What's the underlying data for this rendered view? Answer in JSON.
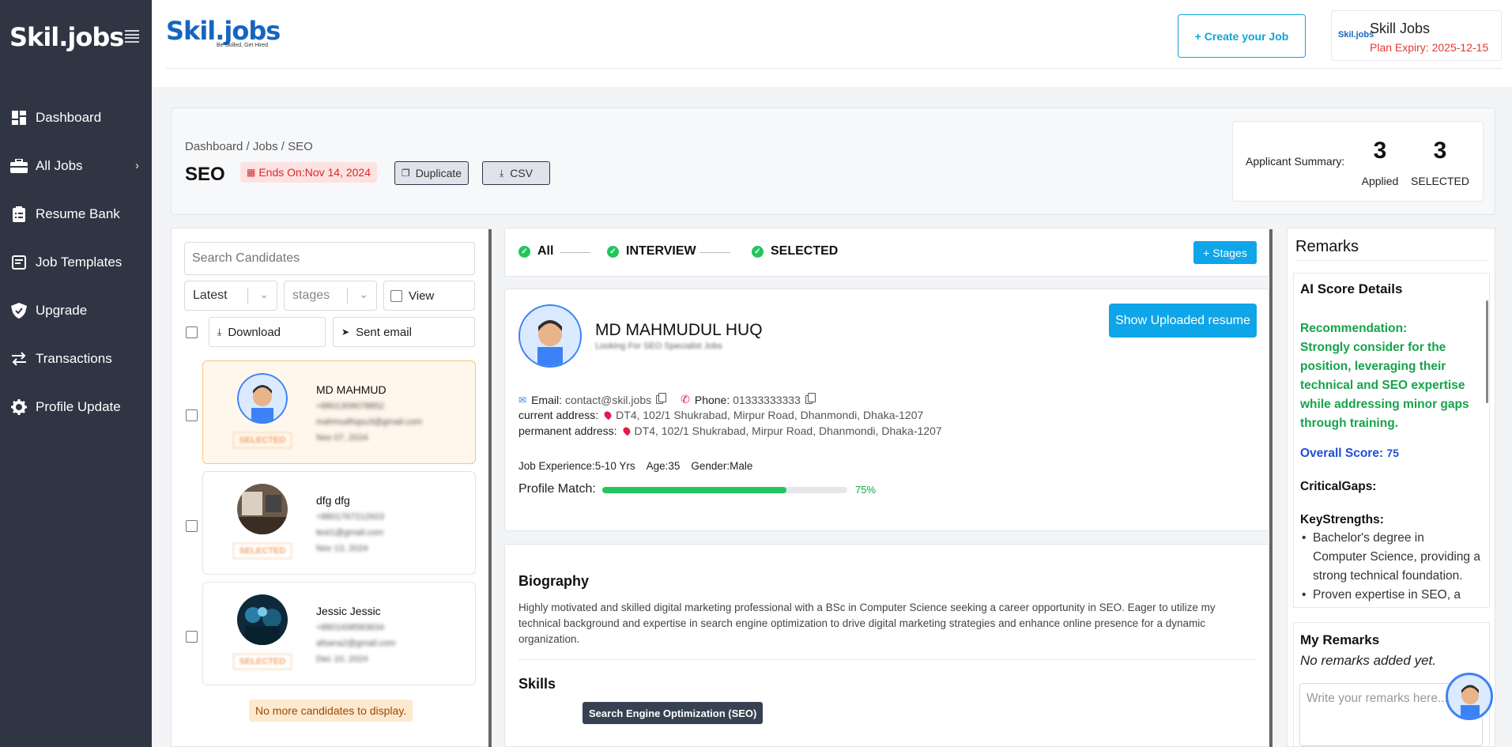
{
  "sidebar": {
    "logo": "Skil.jobs",
    "items": [
      {
        "label": "Dashboard",
        "icon": "dashboard-icon"
      },
      {
        "label": "All Jobs",
        "icon": "briefcase-icon"
      },
      {
        "label": "Resume Bank",
        "icon": "clipboard-icon"
      },
      {
        "label": "Job Templates",
        "icon": "template-icon"
      },
      {
        "label": "Upgrade",
        "icon": "shield-icon"
      },
      {
        "label": "Transactions",
        "icon": "transfer-icon"
      },
      {
        "label": "Profile Update",
        "icon": "gear-icon"
      }
    ]
  },
  "header": {
    "logo": "Skil.jobs",
    "tagline": "Be Skilled, Get Hired",
    "create_label": "+ Create your Job",
    "plan_logo": "Skil.jobs",
    "plan_name": "Skill Jobs",
    "plan_expiry": "Plan Expiry: 2025-12-15"
  },
  "job": {
    "breadcrumb": "Dashboard / Jobs / SEO",
    "title": "SEO",
    "ends": "Ends On:Nov 14, 2024",
    "duplicate_label": "Duplicate",
    "csv_label": "CSV",
    "summary_label": "Applicant Summary:",
    "applied_count": "3",
    "applied_label": "Applied",
    "selected_count": "3",
    "selected_label": "SELECTED"
  },
  "candidates": {
    "search_placeholder": "Search Candidates",
    "sort_value": "Latest",
    "stages_value": "stages",
    "view_label": "View",
    "download_label": "Download",
    "email_label": "Sent email",
    "no_more": "No more candidates to display.",
    "list": [
      {
        "name": "MD MAHMUD",
        "phone": "+8801309078852",
        "email": "mahmudhqsu3@gmail.com",
        "date": "Nov 07, 2024",
        "status": "SELECTED"
      },
      {
        "name": "dfg dfg",
        "phone": "+8801767212923",
        "email": "test1@gmail.com",
        "date": "Nov 13, 2024",
        "status": "SELECTED"
      },
      {
        "name": "Jessic Jessic",
        "phone": "+8801938583634",
        "email": "afsana2@gmail.com",
        "date": "Dec 10, 2024",
        "status": "SELECTED"
      }
    ]
  },
  "stages": {
    "items": [
      "All",
      "INTERVIEW",
      "SELECTED"
    ],
    "add_label": "+ Stages"
  },
  "profile": {
    "name": "MD MAHMUDUL HUQ",
    "subtitle": "Looking For SEO Specialist Jobs",
    "resume_label": "Show Uploaded resume",
    "email_label": "Email:",
    "email": "contact@skil.jobs",
    "phone_label": "Phone:",
    "phone": "01333333333",
    "current_label": "current address:",
    "current_address": "DT4, 102/1 Shukrabad, Mirpur Road, Dhanmondi, Dhaka-1207",
    "permanent_label": "permanent address:",
    "permanent_address": "DT4, 102/1 Shukrabad, Mirpur Road, Dhanmondi, Dhaka-1207",
    "experience": "Job Experience:5-10 Yrs",
    "age": "Age:35",
    "gender": "Gender:Male",
    "match_label": "Profile Match:",
    "match_value": "75%",
    "match_fraction": 0.75
  },
  "bio": {
    "heading": "Biography",
    "text": "Highly motivated and skilled digital marketing professional with a BSc in Computer Science seeking a career opportunity in SEO. Eager to utilize my technical background and expertise in search engine optimization to drive digital marketing strategies and enhance online presence for a dynamic organization.",
    "skills_heading": "Skills",
    "skill": "Search Engine Optimization (SEO)"
  },
  "remarks": {
    "title": "Remarks",
    "ai_heading": "AI Score Details",
    "recommendation_label": "Recommendation:",
    "recommendation": "Strongly consider for the position, leveraging their technical and SEO expertise while addressing minor gaps through training.",
    "score_label": "Overall Score:",
    "score": "75",
    "critical_label": "CriticalGaps:",
    "strengths_label": "KeyStrengths:",
    "strengths": [
      "Bachelor's degree in Computer Science, providing a strong technical foundation.",
      "Proven expertise in SEO, a valuable skill for enhancing"
    ],
    "my_heading": "My Remarks",
    "my_empty": "No remarks added yet.",
    "placeholder": "Write your remarks here..."
  },
  "colors": {
    "sidebar": "#2f3542",
    "accent": "#0ea5e9",
    "success": "#22c55e",
    "danger": "#dc2626"
  }
}
